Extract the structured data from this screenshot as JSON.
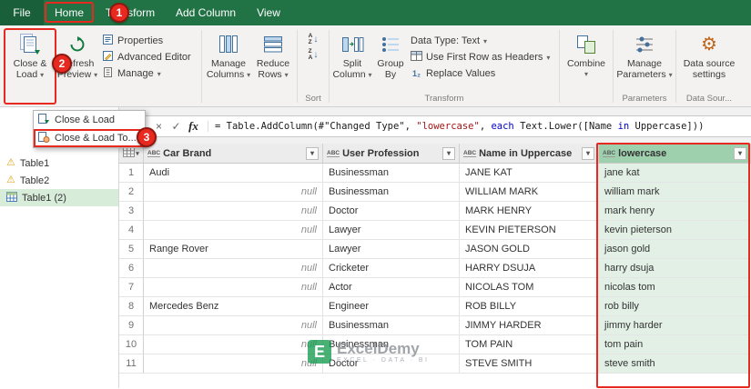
{
  "tab_bar": {
    "tabs": [
      {
        "label": "File"
      },
      {
        "label": "Home"
      },
      {
        "label": "Transform"
      },
      {
        "label": "Add Column"
      },
      {
        "label": "View"
      }
    ]
  },
  "ribbon": {
    "close_load": {
      "line1": "Close &",
      "line2": "Load",
      "arrow": "▾"
    },
    "refresh_preview": {
      "line1": "Refresh",
      "line2": "Preview",
      "arrow": "▾"
    },
    "properties": {
      "label": "Properties"
    },
    "advanced_editor": {
      "label": "Advanced Editor"
    },
    "manage": {
      "label": "Manage",
      "arrow": "▾"
    },
    "manage_columns": {
      "line1": "Manage",
      "line2": "Columns",
      "arrow": "▾"
    },
    "reduce_rows": {
      "line1": "Reduce",
      "line2": "Rows",
      "arrow": "▾"
    },
    "sort_az": {
      "top": "A",
      "bottom": "Z",
      "arrow": "↓"
    },
    "sort_za": {
      "top": "Z",
      "bottom": "A",
      "arrow": "↓"
    },
    "split_column": {
      "line1": "Split",
      "line2": "Column",
      "arrow": "▾"
    },
    "group_by": {
      "line1": "Group",
      "line2": "By"
    },
    "data_type": {
      "label": "Data Type: Text",
      "arrow": "▾"
    },
    "use_first_row": {
      "label": "Use First Row as Headers",
      "arrow": "▾"
    },
    "replace_values": {
      "label": "Replace Values",
      "icon_glyph": "1₂"
    },
    "combine": {
      "line1": "Combine",
      "arrow": "▾"
    },
    "manage_parameters": {
      "line1": "Manage",
      "line2": "Parameters",
      "arrow": "▾"
    },
    "data_source_settings": {
      "line1": "Data source",
      "line2": "settings"
    },
    "group_labels": {
      "sort": "Sort",
      "transform": "Transform",
      "parameters": "Parameters",
      "data_sources": "Data Sour..."
    }
  },
  "callouts": {
    "one": "1",
    "two": "2",
    "three": "3"
  },
  "dropdown_menu": {
    "items": [
      {
        "label": "Close & Load"
      },
      {
        "label": "Close & Load To..."
      }
    ]
  },
  "sidebar": {
    "queries": [
      {
        "name": "Table1",
        "icon": "warning"
      },
      {
        "name": "Table2",
        "icon": "warning"
      },
      {
        "name": "Table1 (2)",
        "icon": "table",
        "selected": true
      }
    ]
  },
  "formula_bar": {
    "cancel_glyph": "×",
    "commit_glyph": "✓",
    "fx_label": "fx",
    "formula_parts": [
      {
        "text": "= Table.AddColumn(#\"Changed Type\", ",
        "color": "#1a1a1a"
      },
      {
        "text": "\"lowercase\"",
        "color": "#a31515"
      },
      {
        "text": ", ",
        "color": "#1a1a1a"
      },
      {
        "text": "each",
        "color": "#0000cd"
      },
      {
        "text": " Text.Lower([Name ",
        "color": "#1a1a1a"
      },
      {
        "text": "in",
        "color": "#0000cd"
      },
      {
        "text": " Uppercase]))",
        "color": "#1a1a1a"
      }
    ]
  },
  "grid": {
    "columns": [
      {
        "name": "Car Brand",
        "type": "ABC"
      },
      {
        "name": "User Profession",
        "type": "ABC"
      },
      {
        "name": "Name in Uppercase",
        "type": "ABC"
      },
      {
        "name": "lowercase",
        "type": "ABC",
        "highlighted": true
      }
    ],
    "rows": [
      {
        "num": "1",
        "cells": [
          "Audi",
          "Businessman",
          "JANE KAT",
          "jane kat"
        ]
      },
      {
        "num": "2",
        "cells": [
          "null",
          "Businessman",
          "WILLIAM MARK",
          "william mark"
        ]
      },
      {
        "num": "3",
        "cells": [
          "null",
          "Doctor",
          "MARK HENRY",
          "mark henry"
        ]
      },
      {
        "num": "4",
        "cells": [
          "null",
          "Lawyer",
          "KEVIN PIETERSON",
          "kevin pieterson"
        ]
      },
      {
        "num": "5",
        "cells": [
          "Range Rover",
          "Lawyer",
          "JASON GOLD",
          "jason gold"
        ]
      },
      {
        "num": "6",
        "cells": [
          "null",
          "Cricketer",
          "HARRY DSUJA",
          "harry dsuja"
        ]
      },
      {
        "num": "7",
        "cells": [
          "null",
          "Actor",
          "NICOLAS TOM",
          "nicolas tom"
        ]
      },
      {
        "num": "8",
        "cells": [
          "Mercedes Benz",
          "Engineer",
          "ROB BILLY",
          "rob billy"
        ]
      },
      {
        "num": "9",
        "cells": [
          "null",
          "Businessman",
          "JIMMY HARDER",
          "jimmy harder"
        ]
      },
      {
        "num": "10",
        "cells": [
          "null",
          "Businessman",
          "TOM PAIN",
          "tom pain"
        ]
      },
      {
        "num": "11",
        "cells": [
          "null",
          "Doctor",
          "STEVE SMITH",
          "steve smith"
        ]
      }
    ]
  },
  "watermark": {
    "logo_letter": "E",
    "name": "ExcelDemy",
    "tagline": "EXCEL · DATA · BI"
  },
  "colors": {
    "brand_green": "#217346",
    "highlight_green": "#e2f0e6",
    "annotation_red": "#e8291f"
  }
}
